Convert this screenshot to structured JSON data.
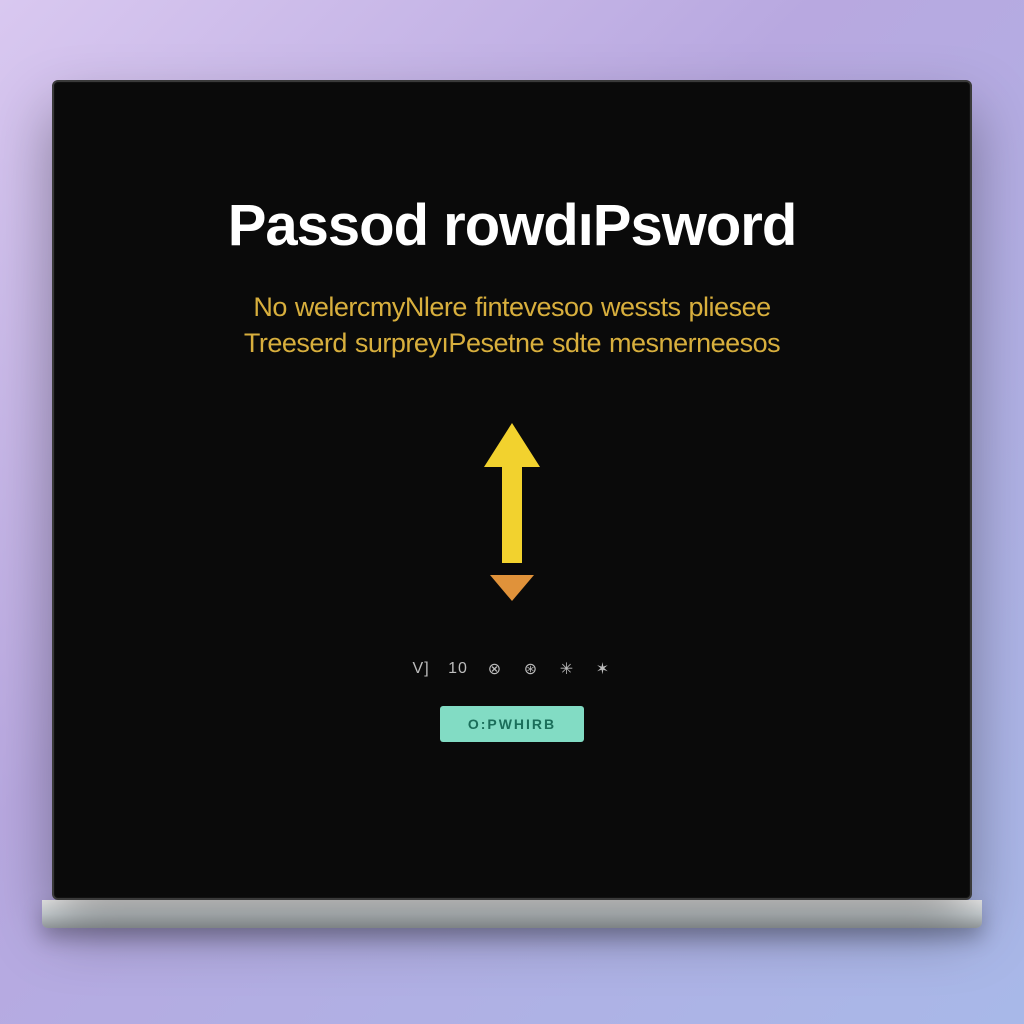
{
  "heading": "Passod rowdıPsword",
  "subtext_line1": "No welercmyNlere fintevesoo wessts pliesee",
  "subtext_line2": "Treeserd surpreyıPesetne sdte mesnerneesos",
  "icons": {
    "arrow_up": "arrow-up-icon",
    "arrow_down": "arrow-down-icon"
  },
  "indicators": {
    "i0": "V]",
    "i1": "10",
    "i2": "⊗",
    "i3": "⊛",
    "i4": "✳",
    "i5": "✶"
  },
  "button_label": "O:PWHIRB",
  "colors": {
    "arrow_up": "#f2d22e",
    "arrow_down": "#e0923a",
    "button_bg": "#82dcc4"
  }
}
